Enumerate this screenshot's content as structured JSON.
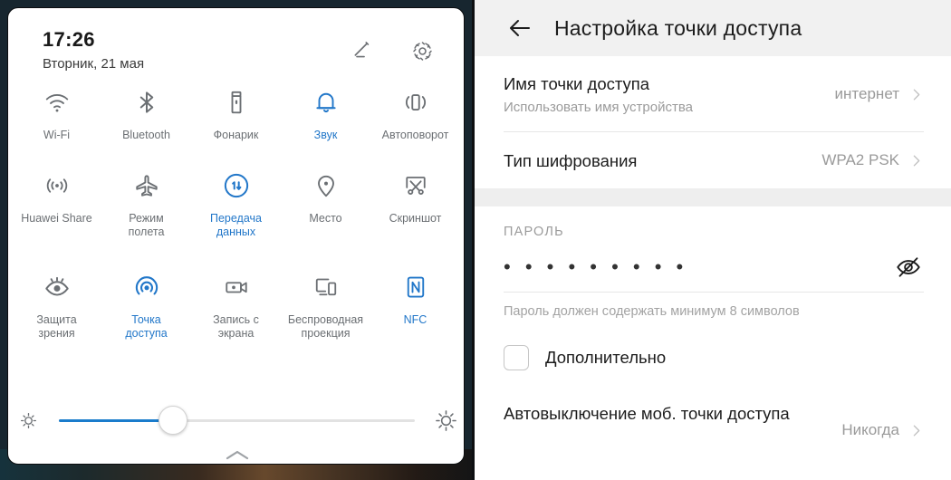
{
  "quick_settings": {
    "time": "17:26",
    "date": "Вторник, 21 мая",
    "header_icons": {
      "edit": "pencil-icon",
      "settings": "gear-icon"
    },
    "accent_color": "#2277c9",
    "inactive_color": "#6b6f73",
    "tiles": [
      {
        "label": "Wi-Fi",
        "icon": "wifi-icon",
        "active": false
      },
      {
        "label": "Bluetooth",
        "icon": "bluetooth-icon",
        "active": false
      },
      {
        "label": "Фонарик",
        "icon": "flashlight-icon",
        "active": false
      },
      {
        "label": "Звук",
        "icon": "bell-icon",
        "active": true
      },
      {
        "label": "Автоповорот",
        "icon": "auto-rotate-icon",
        "active": false
      },
      {
        "label": "Huawei Share",
        "icon": "huawei-share-icon",
        "active": false
      },
      {
        "label": "Режим\nполета",
        "icon": "airplane-icon",
        "active": false
      },
      {
        "label": "Передача\nданных",
        "icon": "mobile-data-icon",
        "active": true
      },
      {
        "label": "Место",
        "icon": "location-pin-icon",
        "active": false
      },
      {
        "label": "Скриншот",
        "icon": "screenshot-icon",
        "active": false
      },
      {
        "label": "Защита\nзрения",
        "icon": "eye-comfort-icon",
        "active": false
      },
      {
        "label": "Точка\nдоступа",
        "icon": "hotspot-icon",
        "active": true
      },
      {
        "label": "Запись с\nэкрана",
        "icon": "screen-record-icon",
        "active": false
      },
      {
        "label": "Беспроводная\nпроекция",
        "icon": "cast-icon",
        "active": false
      },
      {
        "label": "NFC",
        "icon": "nfc-icon",
        "active": true
      }
    ],
    "brightness": {
      "value_percent": 32,
      "low_icon": "brightness-low-icon",
      "high_icon": "brightness-high-icon"
    },
    "collapse_icon": "chevron-up-icon"
  },
  "hotspot_settings": {
    "back_icon": "back-arrow-icon",
    "title": "Настройка точки доступа",
    "rows": {
      "ap_name": {
        "title": "Имя точки доступа",
        "subtitle": "Использовать имя устройства",
        "value": "интернет",
        "chevron": "chevron-right-icon"
      },
      "encryption": {
        "title": "Тип шифрования",
        "value": "WPA2 PSK",
        "chevron": "chevron-right-icon"
      }
    },
    "password_section": {
      "caption": "ПАРОЛЬ",
      "masked_value": "• • • • • • • • •",
      "visibility_icon": "eye-off-icon",
      "hint": "Пароль должен содержать минимум 8 символов"
    },
    "advanced": {
      "label": "Дополнительно",
      "checked": false
    },
    "auto_off": {
      "title": "Автовыключение моб. точки доступа",
      "value": "Никогда",
      "chevron": "chevron-right-icon"
    }
  }
}
